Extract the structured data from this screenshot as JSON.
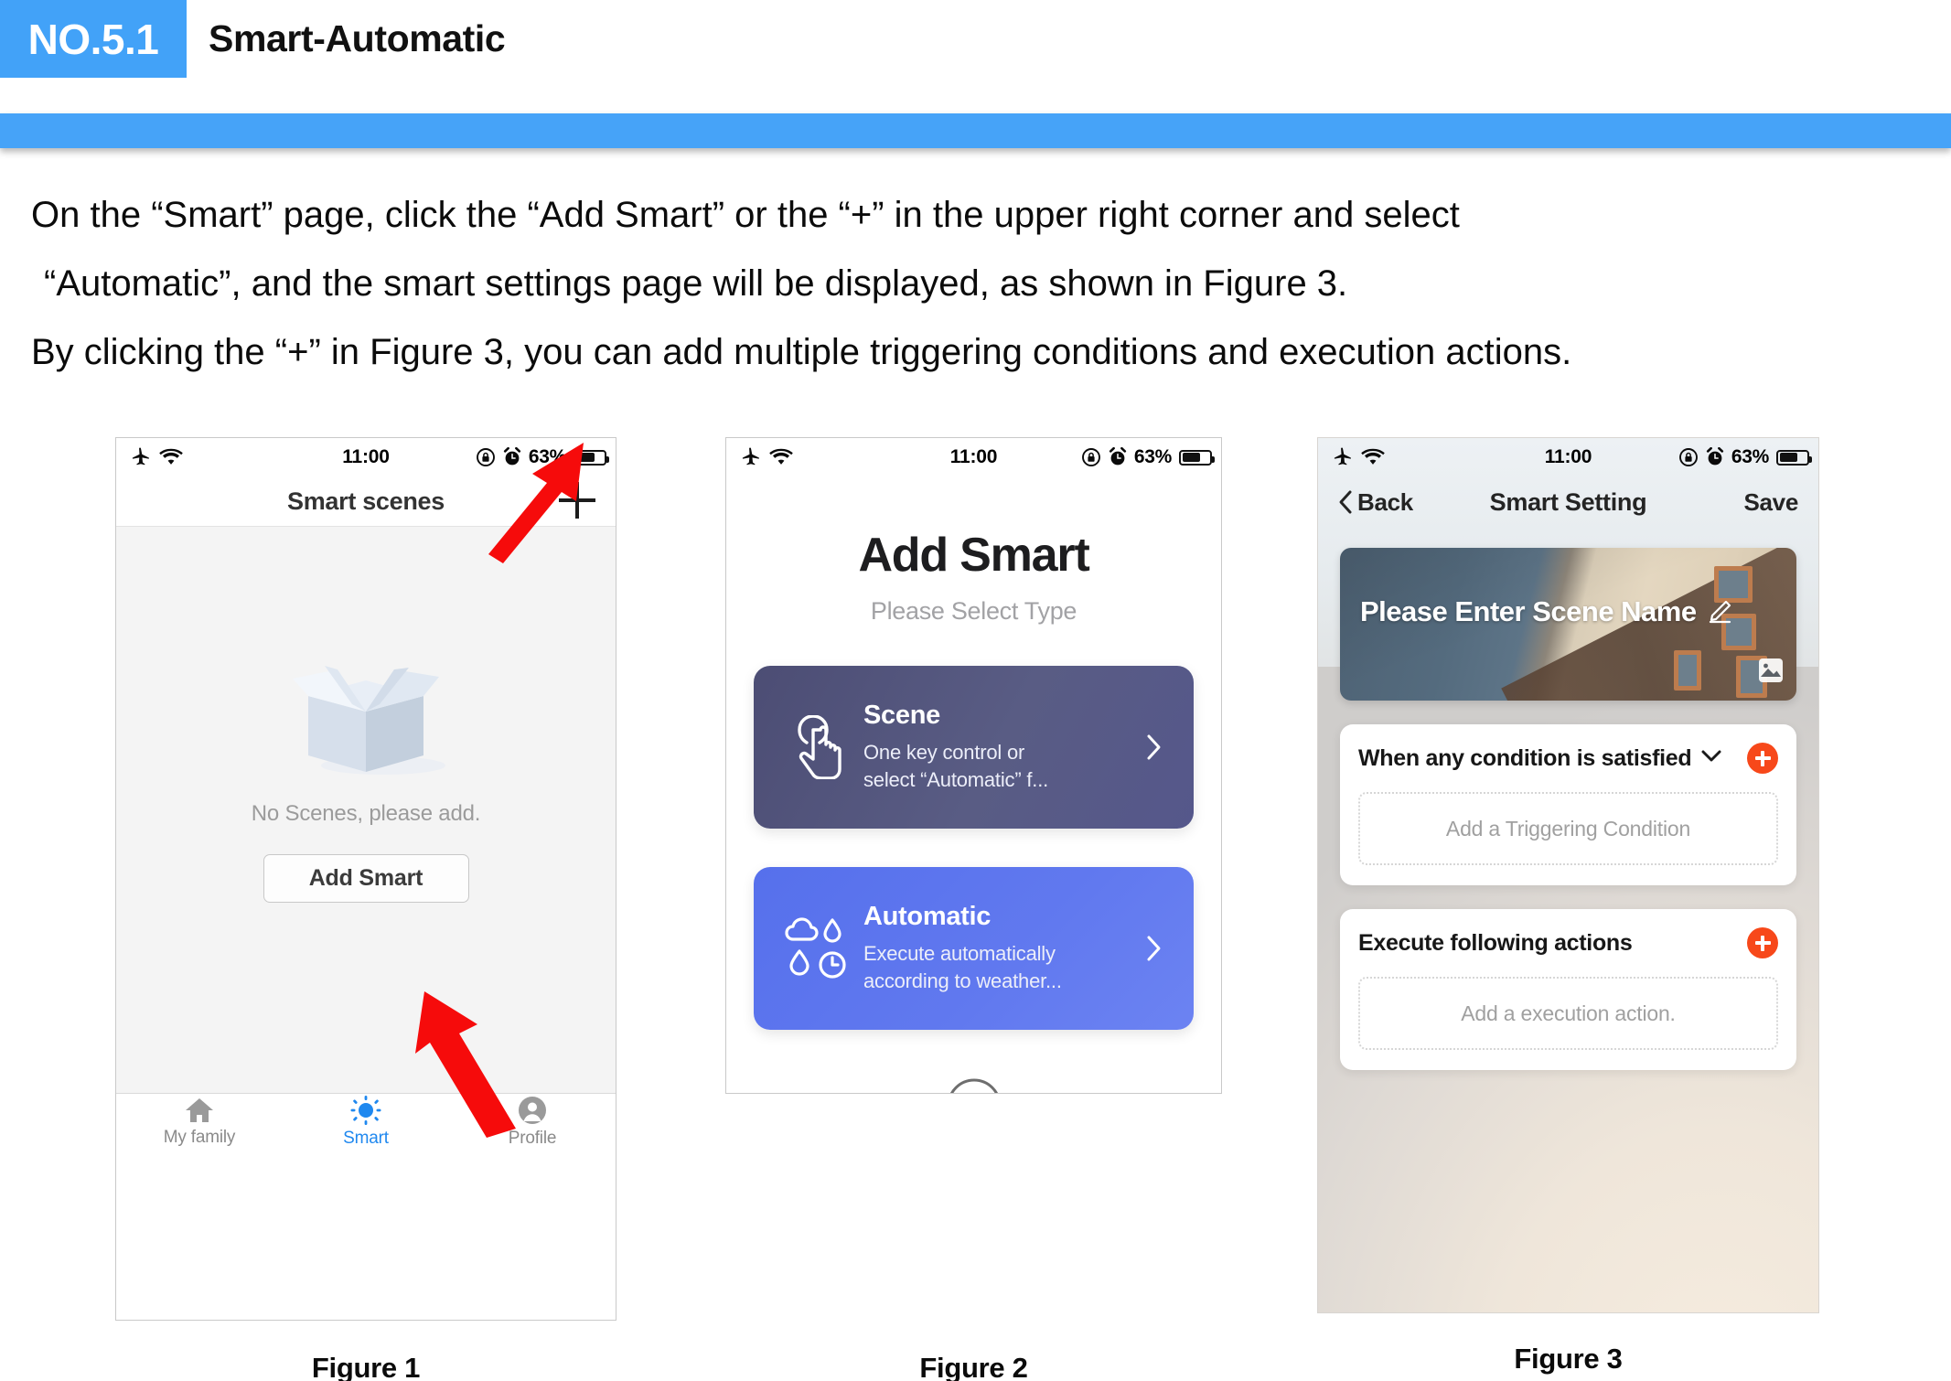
{
  "header": {
    "badge": "NO.5.1",
    "title": "Smart-Automatic"
  },
  "body": {
    "line1": "On the “Smart” page, click the “Add Smart” or the “+” in the upper right corner and select",
    "line2": "“Automatic”, and the smart settings page will be displayed, as shown in Figure 3.",
    "line3": "By clicking the “+” in Figure 3, you can add multiple triggering conditions and execution actions."
  },
  "status_bar": {
    "time": "11:00",
    "battery_percent": "63%",
    "airplane_icon": "airplane-mode-icon",
    "wifi_icon": "wifi-icon",
    "rotation_lock_icon": "rotation-lock-icon",
    "alarm_icon": "alarm-clock-icon",
    "battery_icon": "battery-icon"
  },
  "figure1": {
    "caption": "Figure 1",
    "nav_title": "Smart scenes",
    "add_icon": "plus-icon",
    "empty_illustration": "open-box-illustration",
    "empty_message": "No Scenes, please add.",
    "add_smart_button": "Add Smart",
    "tabs": [
      {
        "label": "My family",
        "icon": "home-icon",
        "active": false
      },
      {
        "label": "Smart",
        "icon": "sun-icon",
        "active": true
      },
      {
        "label": "Profile",
        "icon": "person-icon",
        "active": false
      }
    ]
  },
  "figure2": {
    "caption": "Figure 2",
    "title": "Add Smart",
    "subtitle": "Please Select Type",
    "cards": [
      {
        "title": "Scene",
        "desc": "One key control or\nselect “Automatic” f...",
        "desc_line1": "One key control or",
        "desc_line2": "select “Automatic” f...",
        "icon": "tap-hand-icon",
        "chevron": "chevron-right-icon",
        "color": "#55578b"
      },
      {
        "title": "Automatic",
        "desc_line1": "Execute automatically",
        "desc_line2": "according to weather...",
        "icon": "weather-cloud-drop-clock-icon",
        "chevron": "chevron-right-icon",
        "color": "#6179ef"
      }
    ],
    "close_icon": "close-circle-icon"
  },
  "figure3": {
    "caption": "Figure 3",
    "back_label": "Back",
    "back_icon": "chevron-left-icon",
    "nav_title": "Smart Setting",
    "save_label": "Save",
    "scene_name_placeholder": "Please Enter Scene Name",
    "edit_icon": "pencil-edit-icon",
    "image_picker_icon": "image-picker-icon",
    "hero_image": "house-photo",
    "condition_section": {
      "title": "When any condition is satisfied",
      "dropdown_icon": "chevron-down-icon",
      "add_icon": "plus-circle-icon",
      "add_color": "#f7481a",
      "placeholder": "Add a Triggering Condition"
    },
    "action_section": {
      "title": "Execute following actions",
      "add_icon": "plus-circle-icon",
      "add_color": "#f7481a",
      "placeholder": "Add a execution action."
    }
  }
}
